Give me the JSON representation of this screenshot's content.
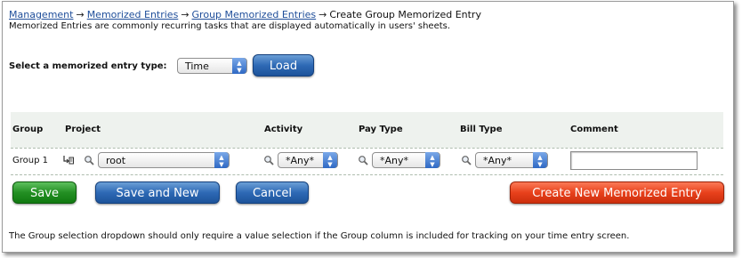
{
  "breadcrumb": {
    "items": [
      {
        "label": "Management"
      },
      {
        "label": "Memorized Entries"
      },
      {
        "label": "Group Memorized Entries"
      }
    ],
    "current": "Create Group Memorized Entry",
    "separator": "→"
  },
  "subtitle": "Memorized Entries are commonly recurring tasks that are displayed automatically in users' sheets.",
  "entry_type": {
    "label": "Select a memorized entry type:",
    "selected": "Time",
    "load_button": "Load"
  },
  "table": {
    "headers": {
      "group": "Group",
      "project": "Project",
      "activity": "Activity",
      "pay_type": "Pay Type",
      "bill_type": "Bill Type",
      "comment": "Comment"
    },
    "row": {
      "group": "Group 1",
      "project": "root",
      "activity": "*Any*",
      "pay_type": "*Any*",
      "bill_type": "*Any*",
      "comment": ""
    }
  },
  "buttons": {
    "save": "Save",
    "save_and_new": "Save and New",
    "cancel": "Cancel",
    "create_new": "Create New Memorized Entry"
  },
  "note": "The Group selection dropdown should only require a value selection if the Group column is included for tracking on your time entry screen.",
  "colors": {
    "link": "#1f4e9a",
    "primary_button": "#2e69b5",
    "save_button": "#238f23",
    "create_button": "#e8411c",
    "header_background": "#eef2ee"
  },
  "icons": {
    "tree": "tree-picker-icon",
    "search": "magnifier-icon",
    "dropdown": "up-down-arrows-icon"
  }
}
